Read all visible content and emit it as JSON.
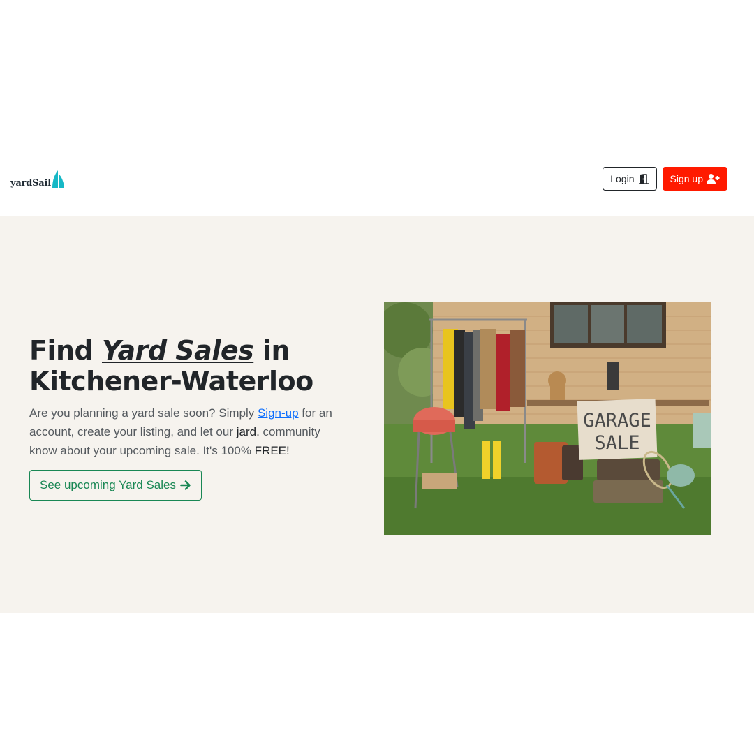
{
  "brand": {
    "name": "yardSail",
    "accent_color": "#16b8c6"
  },
  "nav": {
    "login_label": "Login",
    "login_icon": "door-open-icon",
    "signup_label": "Sign up",
    "signup_icon": "user-plus-icon",
    "signup_color": "#ff1a00"
  },
  "hero": {
    "title_prefix": "Find",
    "title_highlight": "Yard Sales",
    "title_suffix": "in",
    "title_line2": "Kitchener-Waterloo",
    "text_part1": "Are you planning a yard sale soon? Simply ",
    "signup_link": "Sign-up",
    "text_part2": " for an account, create your listing, and let our ",
    "community_name": "jard.",
    "text_part3": " community know about your upcoming sale. It's 100% ",
    "free_text": "FREE!",
    "cta_label": "See upcoming Yard Sales",
    "cta_icon": "arrow-right-icon",
    "cta_color": "#198754",
    "background": "#f6f3ee",
    "image_sign_line1": "GARAGE",
    "image_sign_line2": "SALE"
  }
}
